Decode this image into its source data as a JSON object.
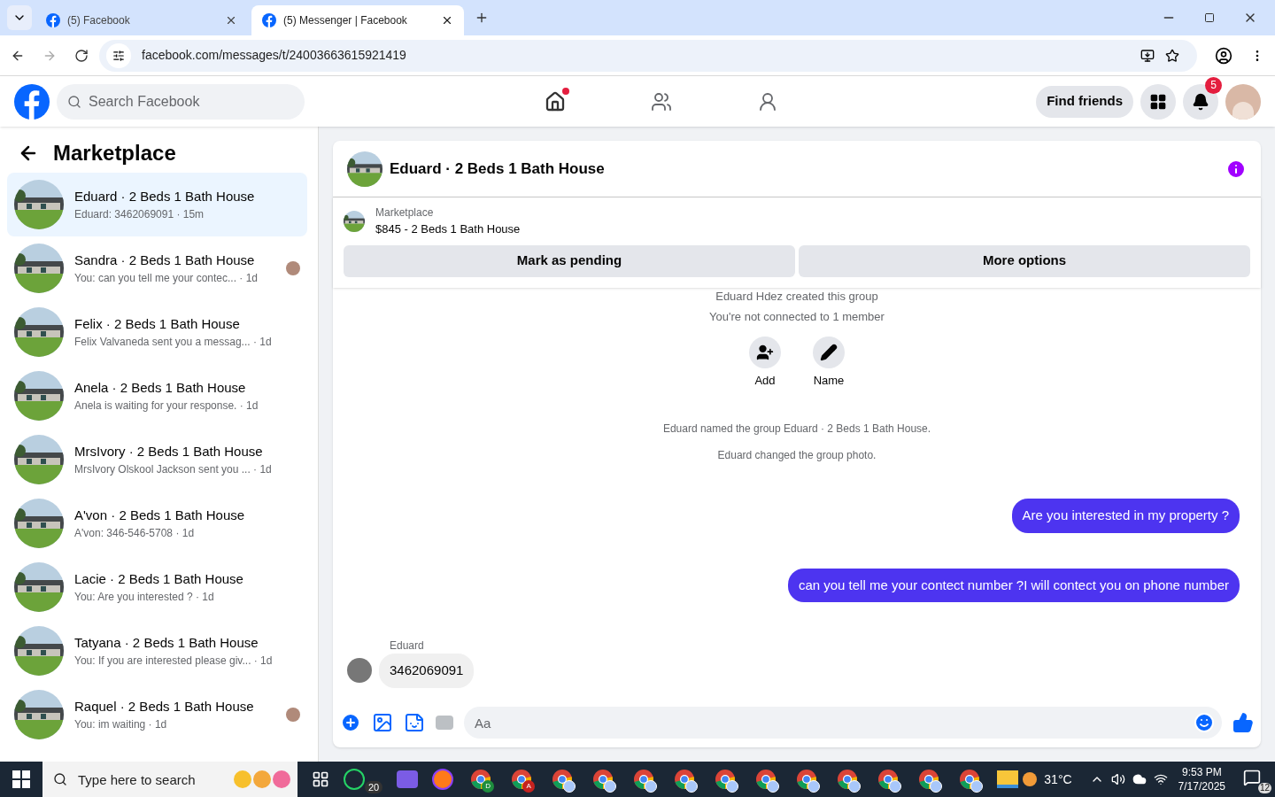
{
  "browser": {
    "tabs": [
      {
        "title": "(5) Facebook",
        "selected": false
      },
      {
        "title": "(5) Messenger | Facebook",
        "selected": true
      }
    ],
    "url": "facebook.com/messages/t/24003663615921419"
  },
  "header": {
    "search_placeholder": "Search Facebook",
    "nav": [
      {
        "kind": "home",
        "selected": true,
        "dot": true
      },
      {
        "kind": "friends",
        "selected": false,
        "dot": false
      },
      {
        "kind": "groups",
        "selected": false,
        "dot": false
      }
    ],
    "find_friends": "Find friends",
    "notifications_badge": "5"
  },
  "sidebar": {
    "title": "Marketplace",
    "items": [
      {
        "title": "Eduard · 2 Beds 1 Bath House",
        "preview": "Eduard: 3462069091 · 15m",
        "selected": true,
        "seen": false
      },
      {
        "title": "Sandra · 2 Beds 1 Bath House",
        "preview": "You: can you tell me your contec... · 1d",
        "selected": false,
        "seen": true
      },
      {
        "title": "Felix · 2 Beds 1 Bath House",
        "preview": "Felix Valvaneda sent you a messag... · 1d",
        "selected": false,
        "seen": false
      },
      {
        "title": "Anela · 2 Beds 1 Bath House",
        "preview": "Anela is waiting for your response. · 1d",
        "selected": false,
        "seen": false
      },
      {
        "title": "MrsIvory · 2 Beds 1 Bath House",
        "preview": "MrsIvory Olskool Jackson sent you ... · 1d",
        "selected": false,
        "seen": false
      },
      {
        "title": "A'von · 2 Beds 1 Bath House",
        "preview": "A'von: 346-546-5708 · 1d",
        "selected": false,
        "seen": false
      },
      {
        "title": "Lacie · 2 Beds 1 Bath House",
        "preview": "You: Are you interested ? · 1d",
        "selected": false,
        "seen": false
      },
      {
        "title": "Tatyana · 2 Beds 1 Bath House",
        "preview": "You: If you are interested please giv... · 1d",
        "selected": false,
        "seen": false
      },
      {
        "title": "Raquel · 2 Beds 1 Bath House",
        "preview": "You: im waiting · 1d",
        "selected": false,
        "seen": true
      }
    ]
  },
  "chat": {
    "title": "Eduard · 2 Beds 1 Bath House",
    "listing": {
      "label": "Marketplace",
      "text": "$845 - 2 Beds 1 Bath House"
    },
    "actions": [
      "Mark as pending",
      "More options"
    ],
    "events": [
      "Eduard Hdez created this group",
      "You're not connected to 1 member"
    ],
    "group_actions": [
      {
        "kind": "add",
        "label": "Add"
      },
      {
        "kind": "name",
        "label": "Name"
      }
    ],
    "messages": [
      {
        "kind": "notice",
        "text": "Eduard named the group Eduard · 2 Beds 1 Bath House."
      },
      {
        "kind": "notice",
        "text": "Eduard changed the group photo."
      },
      {
        "kind": "outgoing",
        "text": "Are you interested in my property ?"
      },
      {
        "kind": "outgoing",
        "text": "can you tell me your contect number ?I will contect you on phone number"
      },
      {
        "kind": "incoming",
        "sender": "Eduard",
        "text": "3462069091"
      }
    ],
    "composer_placeholder": "Aa"
  },
  "taskbar": {
    "search_placeholder": "Type here to search",
    "whatsapp_badge": "20",
    "chrome_profiles": [
      "D",
      "A"
    ],
    "temperature": "31°C",
    "time": "9:53 PM",
    "date": "7/17/2025",
    "notifications": "12"
  }
}
